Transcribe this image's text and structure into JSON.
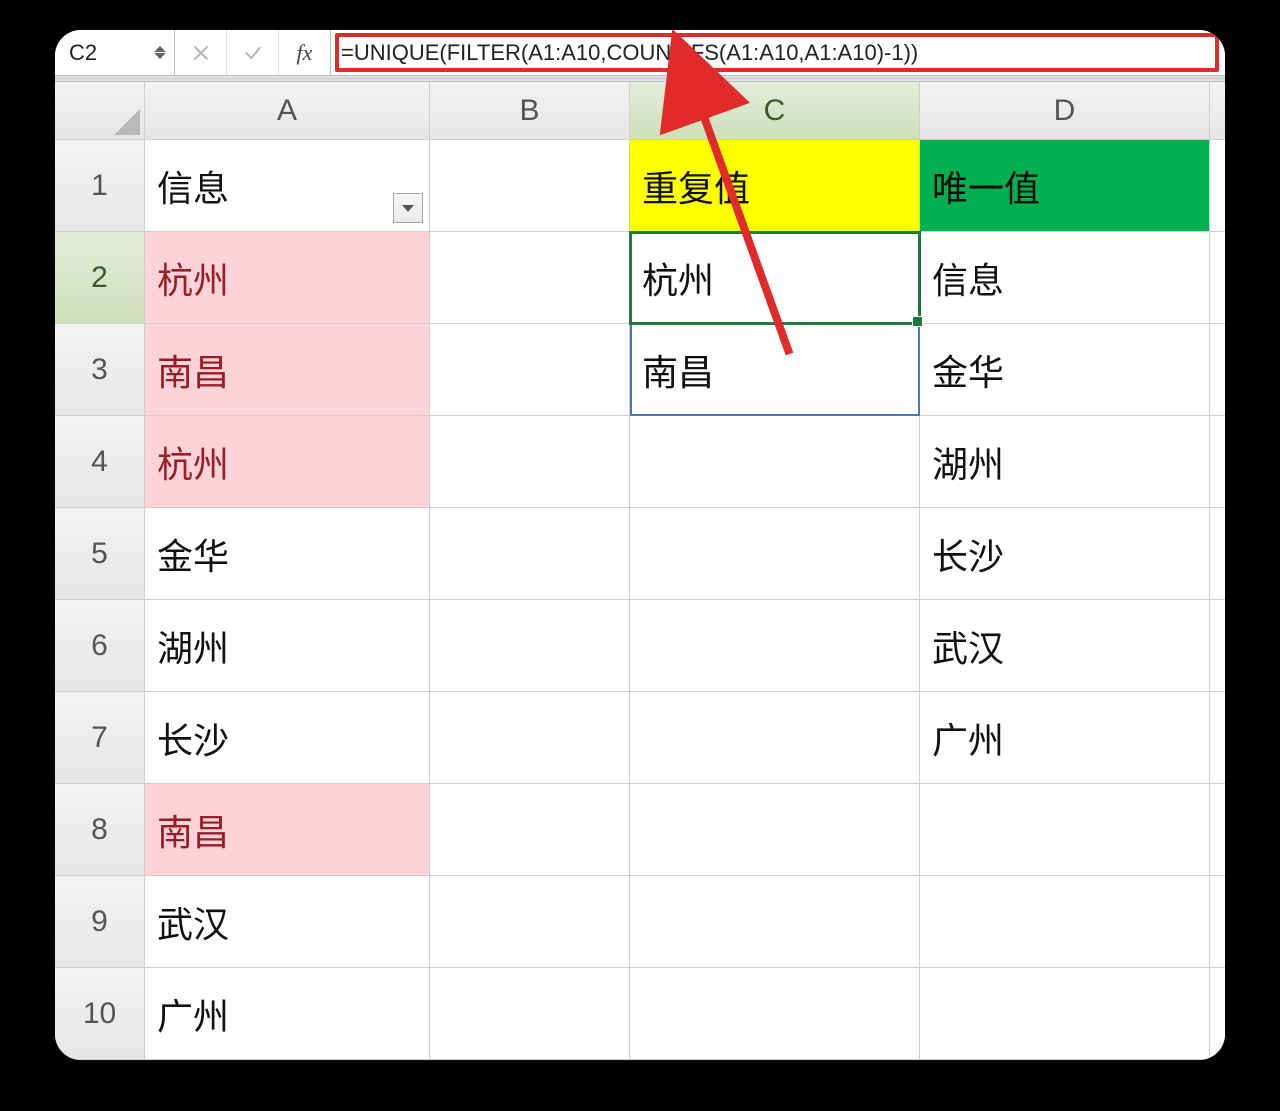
{
  "namebox": {
    "value": "C2"
  },
  "formula": "=UNIQUE(FILTER(A1:A10,COUNTIFS(A1:A10,A1:A10)-1))",
  "columns": [
    "A",
    "B",
    "C",
    "D"
  ],
  "rows": [
    "1",
    "2",
    "3",
    "4",
    "5",
    "6",
    "7",
    "8",
    "9",
    "10"
  ],
  "active": {
    "col": "C",
    "row": "2"
  },
  "labels": {
    "fx": "fx"
  },
  "cells": {
    "A1": {
      "v": "信息"
    },
    "A2": {
      "v": "杭州",
      "cls": "pink"
    },
    "A3": {
      "v": "南昌",
      "cls": "pink"
    },
    "A4": {
      "v": "杭州",
      "cls": "pink"
    },
    "A5": {
      "v": "金华"
    },
    "A6": {
      "v": "湖州"
    },
    "A7": {
      "v": "长沙"
    },
    "A8": {
      "v": "南昌",
      "cls": "pink"
    },
    "A9": {
      "v": "武汉"
    },
    "A10": {
      "v": "广州"
    },
    "C1": {
      "v": "重复值",
      "cls": "yellow"
    },
    "C2": {
      "v": "杭州"
    },
    "C3": {
      "v": "南昌"
    },
    "D1": {
      "v": "唯一值",
      "cls": "green"
    },
    "D2": {
      "v": "信息"
    },
    "D3": {
      "v": "金华"
    },
    "D4": {
      "v": "湖州"
    },
    "D5": {
      "v": "长沙"
    },
    "D6": {
      "v": "武汉"
    },
    "D7": {
      "v": "广州"
    }
  },
  "highlight_colors": {
    "pink_bg": "#fbd3d8",
    "yellow_bg": "#ffff00",
    "green_bg": "#00b050",
    "selection": "#1f7a3e",
    "spill": "#3f7ac9",
    "annotation": "#e12a2a"
  },
  "chart_data": {
    "type": "table",
    "columns": [
      "A",
      "B",
      "C",
      "D"
    ],
    "rows": [
      [
        "信息",
        "",
        "重复值",
        "唯一值"
      ],
      [
        "杭州",
        "",
        "杭州",
        "信息"
      ],
      [
        "南昌",
        "",
        "南昌",
        "金华"
      ],
      [
        "杭州",
        "",
        "",
        "湖州"
      ],
      [
        "金华",
        "",
        "",
        "长沙"
      ],
      [
        "湖州",
        "",
        "",
        "武汉"
      ],
      [
        "长沙",
        "",
        "",
        "广州"
      ],
      [
        "南昌",
        "",
        "",
        ""
      ],
      [
        "武汉",
        "",
        "",
        ""
      ],
      [
        "广州",
        "",
        "",
        ""
      ]
    ],
    "title": "",
    "xlabel": "",
    "ylabel": ""
  }
}
